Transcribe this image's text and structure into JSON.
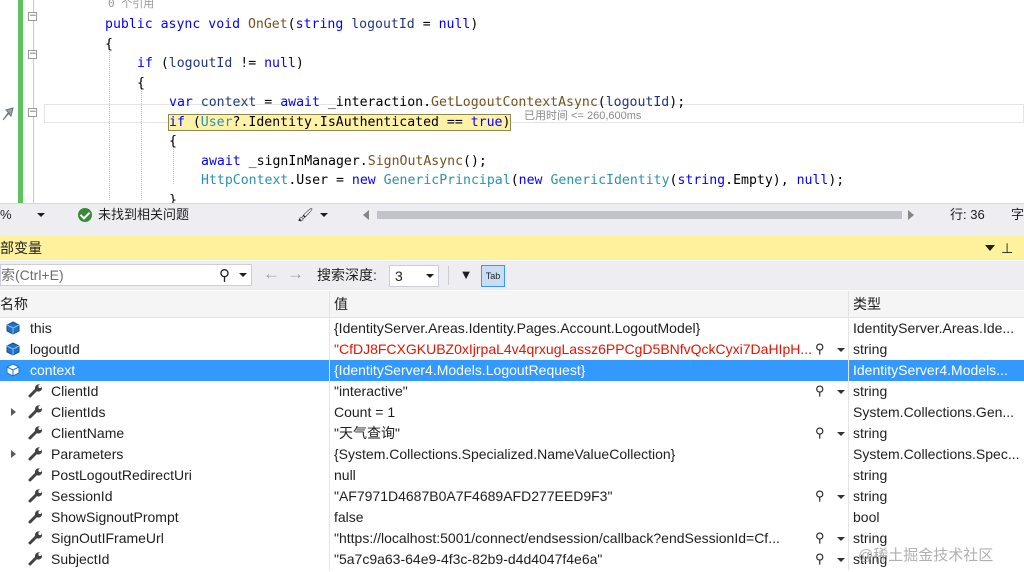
{
  "editor": {
    "code_lines": [
      {
        "segments": [
          {
            "t": "0 个引用",
            "c": "hint"
          }
        ]
      },
      {
        "segments": [
          {
            "t": "public",
            "c": "kw"
          },
          {
            "t": " "
          },
          {
            "t": "async",
            "c": "kw"
          },
          {
            "t": " "
          },
          {
            "t": "void",
            "c": "kw"
          },
          {
            "t": " "
          },
          {
            "t": "OnGet",
            "c": "mt"
          },
          {
            "t": "("
          },
          {
            "t": "string",
            "c": "kw"
          },
          {
            "t": " "
          },
          {
            "t": "logoutId",
            "c": "vr"
          },
          {
            "t": " = "
          },
          {
            "t": "null",
            "c": "kw"
          },
          {
            "t": ")"
          }
        ]
      },
      {
        "segments": [
          {
            "t": "{"
          }
        ]
      },
      {
        "segments": [
          {
            "t": "if",
            "c": "kw"
          },
          {
            "t": " ("
          },
          {
            "t": "logoutId",
            "c": "vr"
          },
          {
            "t": " != "
          },
          {
            "t": "null",
            "c": "kw"
          },
          {
            "t": ")"
          }
        ]
      },
      {
        "segments": [
          {
            "t": "{"
          }
        ]
      },
      {
        "segments": [
          {
            "t": "var",
            "c": "kw"
          },
          {
            "t": " "
          },
          {
            "t": "context",
            "c": "vr"
          },
          {
            "t": " = "
          },
          {
            "t": "await",
            "c": "kw"
          },
          {
            "t": " _interaction."
          },
          {
            "t": "GetLogoutContextAsync",
            "c": "mt"
          },
          {
            "t": "("
          },
          {
            "t": "logoutId",
            "c": "vr"
          },
          {
            "t": ");"
          }
        ]
      },
      {
        "segments": [
          {
            "t": "if",
            "c": "kw"
          },
          {
            "t": " ("
          },
          {
            "t": "User",
            "c": "ty"
          },
          {
            "t": "?.Identity.IsAuthenticated == "
          },
          {
            "t": "true",
            "c": "kw"
          },
          {
            "t": ")"
          }
        ]
      },
      {
        "segments": [
          {
            "t": "{"
          }
        ]
      },
      {
        "segments": [
          {
            "t": "await",
            "c": "kw"
          },
          {
            "t": " _signInManager."
          },
          {
            "t": "SignOutAsync",
            "c": "mt"
          },
          {
            "t": "();"
          }
        ]
      },
      {
        "segments": [
          {
            "t": "HttpContext",
            "c": "ty"
          },
          {
            "t": ".User = "
          },
          {
            "t": "new",
            "c": "kw"
          },
          {
            "t": " "
          },
          {
            "t": "GenericPrincipal",
            "c": "ty"
          },
          {
            "t": "("
          },
          {
            "t": "new",
            "c": "kw"
          },
          {
            "t": " "
          },
          {
            "t": "GenericIdentity",
            "c": "ty"
          },
          {
            "t": "("
          },
          {
            "t": "string",
            "c": "kw"
          },
          {
            "t": ".Empty), "
          },
          {
            "t": "null",
            "c": "kw"
          },
          {
            "t": ");"
          }
        ]
      },
      {
        "segments": [
          {
            "t": "}"
          }
        ]
      }
    ],
    "perf_tip": "已用时间 <= 260,600ms"
  },
  "editor_status": {
    "zoom": "%",
    "issues": "未找到相关问题",
    "line": "行: 36",
    "char": "字"
  },
  "panel": {
    "title": "部变量",
    "search_placeholder": "索(Ctrl+E)",
    "depth_label": "搜索深度:",
    "depth_value": "3",
    "columns": {
      "name": "名称",
      "value": "值",
      "type": "类型"
    }
  },
  "variables": [
    {
      "name": "this",
      "value": "{IdentityServer.Areas.Identity.Pages.Account.LogoutModel}",
      "type": "IdentityServer.Areas.Ide...",
      "level": 0,
      "icon": "object-icon",
      "expandable": false,
      "selected": false,
      "red": false,
      "viewer": false
    },
    {
      "name": "logoutId",
      "value": "\"CfDJ8FCXGKUBZ0xIjrpaL4v4qrxugLassz6PPCgD5BNfvQckCyxi7DaHIpH...",
      "type": "string",
      "level": 0,
      "icon": "object-icon",
      "expandable": false,
      "selected": false,
      "red": true,
      "viewer": true
    },
    {
      "name": "context",
      "value": "{IdentityServer4.Models.LogoutRequest}",
      "type": "IdentityServer4.Models...",
      "level": 0,
      "icon": "object-icon",
      "expandable": false,
      "selected": true,
      "red": false,
      "viewer": false
    },
    {
      "name": "ClientId",
      "value": "\"interactive\"",
      "type": "string",
      "level": 1,
      "icon": "wrench-icon",
      "expandable": false,
      "selected": false,
      "red": false,
      "viewer": true
    },
    {
      "name": "ClientIds",
      "value": "Count = 1",
      "type": "System.Collections.Gen...",
      "level": 1,
      "icon": "wrench-icon",
      "expandable": true,
      "selected": false,
      "red": false,
      "viewer": false
    },
    {
      "name": "ClientName",
      "value": "\"天气查询\"",
      "type": "string",
      "level": 1,
      "icon": "wrench-icon",
      "expandable": false,
      "selected": false,
      "red": false,
      "viewer": true
    },
    {
      "name": "Parameters",
      "value": "{System.Collections.Specialized.NameValueCollection}",
      "type": "System.Collections.Spec...",
      "level": 1,
      "icon": "wrench-icon",
      "expandable": true,
      "selected": false,
      "red": false,
      "viewer": false
    },
    {
      "name": "PostLogoutRedirectUri",
      "value": "null",
      "type": "string",
      "level": 1,
      "icon": "wrench-icon",
      "expandable": false,
      "selected": false,
      "red": false,
      "viewer": false
    },
    {
      "name": "SessionId",
      "value": "\"AF7971D4687B0A7F4689AFD277EED9F3\"",
      "type": "string",
      "level": 1,
      "icon": "wrench-icon",
      "expandable": false,
      "selected": false,
      "red": false,
      "viewer": true
    },
    {
      "name": "ShowSignoutPrompt",
      "value": "false",
      "type": "bool",
      "level": 1,
      "icon": "wrench-icon",
      "expandable": false,
      "selected": false,
      "red": false,
      "viewer": false
    },
    {
      "name": "SignOutIFrameUrl",
      "value": "\"https://localhost:5001/connect/endsession/callback?endSessionId=Cf...",
      "type": "string",
      "level": 1,
      "icon": "wrench-icon",
      "expandable": false,
      "selected": false,
      "red": false,
      "viewer": true
    },
    {
      "name": "SubjectId",
      "value": "\"5a7c9a63-64e9-4f3c-82b9-d4d4047f4e6a\"",
      "type": "string",
      "level": 1,
      "icon": "wrench-icon",
      "expandable": false,
      "selected": false,
      "red": false,
      "viewer": true
    }
  ],
  "watermark": "@稀土掘金技术社区",
  "colors": {
    "accent": "#3399ff",
    "panel_title_bg": "#fff29d",
    "gutter_changed": "#5cc35c",
    "error_text": "#e51400"
  }
}
